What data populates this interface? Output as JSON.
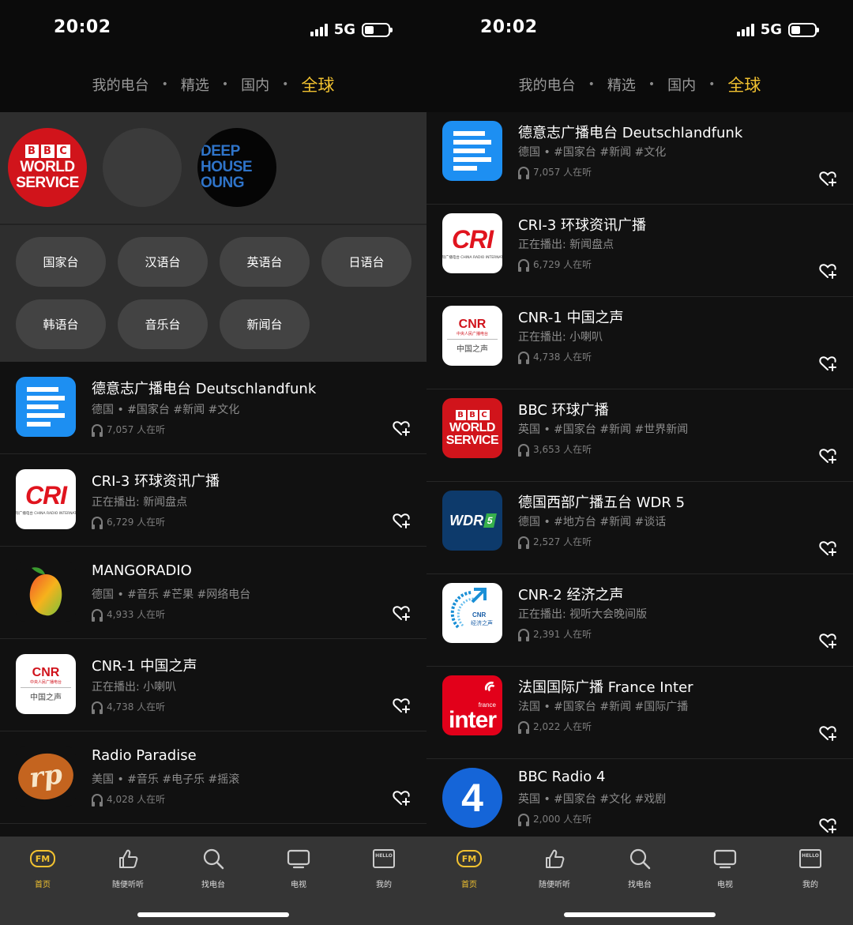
{
  "status": {
    "time": "20:02",
    "network": "5G"
  },
  "topnav": {
    "tabs": [
      "我的电台",
      "精选",
      "国内",
      "全球"
    ],
    "active": "全球",
    "separator": "•"
  },
  "feature": {
    "logos": [
      {
        "name": "BBC World Service",
        "blocks": [
          "B",
          "B",
          "C"
        ],
        "lines": [
          "WORLD",
          "SERVICE"
        ]
      },
      {
        "name": "blank"
      },
      {
        "name": "Deep House Lounge",
        "lines": [
          "DEEP",
          "HOUSE",
          "OUNG"
        ]
      }
    ],
    "chips": [
      "国家台",
      "汉语台",
      "英语台",
      "日语台",
      "韩语台",
      "音乐台",
      "新闻台"
    ]
  },
  "left_list": [
    {
      "title": "德意志广播电台 Deutschlandfunk",
      "tags": "德国 • #国家台 #新闻 #文化",
      "listeners": "7,057 人在听",
      "logo": "dlf"
    },
    {
      "title": "CRI-3 环球资讯广播",
      "tags": "正在播出: 新闻盘点",
      "listeners": "6,729 人在听",
      "logo": "cri"
    },
    {
      "title": "MANGORADIO",
      "tags": "德国 • #音乐 #芒果 #网络电台",
      "listeners": "4,933 人在听",
      "logo": "mango"
    },
    {
      "title": "CNR-1 中国之声",
      "tags": "正在播出: 小喇叭",
      "listeners": "4,738 人在听",
      "logo": "cnr1"
    },
    {
      "title": "Radio Paradise",
      "tags": "美国 • #音乐 #电子乐 #摇滚",
      "listeners": "4,028 人在听",
      "logo": "rp"
    }
  ],
  "right_list": [
    {
      "title": "德意志广播电台 Deutschlandfunk",
      "tags": "德国 • #国家台 #新闻 #文化",
      "listeners": "7,057 人在听",
      "logo": "dlf"
    },
    {
      "title": "CRI-3 环球资讯广播",
      "tags": "正在播出: 新闻盘点",
      "listeners": "6,729 人在听",
      "logo": "cri"
    },
    {
      "title": "CNR-1 中国之声",
      "tags": "正在播出: 小喇叭",
      "listeners": "4,738 人在听",
      "logo": "cnr1"
    },
    {
      "title": "BBC 环球广播",
      "tags": "英国 • #国家台 #新闻 #世界新闻",
      "listeners": "3,653 人在听",
      "logo": "bbc"
    },
    {
      "title": "德国西部广播五台 WDR 5",
      "tags": "德国 • #地方台 #新闻 #谈话",
      "listeners": "2,527 人在听",
      "logo": "wdr"
    },
    {
      "title": "CNR-2 经济之声",
      "tags": "正在播出: 视听大会晚间版",
      "listeners": "2,391 人在听",
      "logo": "cnr2"
    },
    {
      "title": "法国国际广播 France Inter",
      "tags": "法国 • #国家台 #新闻 #国际广播",
      "listeners": "2,022 人在听",
      "logo": "france"
    },
    {
      "title": "BBC Radio 4",
      "tags": "英国 • #国家台 #文化 #戏剧",
      "listeners": "2,000 人在听",
      "logo": "r4"
    }
  ],
  "logo_text": {
    "cri": "CRI",
    "cri_sub": "中国国际广播电台 CHINA RADIO INTERNATIONAL",
    "cnr": "CNR",
    "cnr_sub1": "中央人民广播电台",
    "cnr_sub2": "中国之声",
    "cnr2_sub1": "CNR",
    "cnr2_sub2": "经济之声",
    "rp": "rp",
    "wdr": "WDR",
    "wdr_num": "5",
    "france_small": "france",
    "france_big": "inter",
    "r4": "4"
  },
  "bottom_nav": [
    {
      "label": "首页",
      "icon": "fm-icon",
      "active": true,
      "icon_text": "FM"
    },
    {
      "label": "随便听听",
      "icon": "thumbs-up-icon",
      "active": false
    },
    {
      "label": "找电台",
      "icon": "search-icon",
      "active": false
    },
    {
      "label": "电视",
      "icon": "tv-icon",
      "active": false
    },
    {
      "label": "我的",
      "icon": "hello-icon",
      "active": false,
      "icon_text": "HELLO"
    }
  ],
  "colors": {
    "accent": "#f2c230",
    "bbc_red": "#d1141b",
    "dlf_blue": "#1d8ff2"
  }
}
